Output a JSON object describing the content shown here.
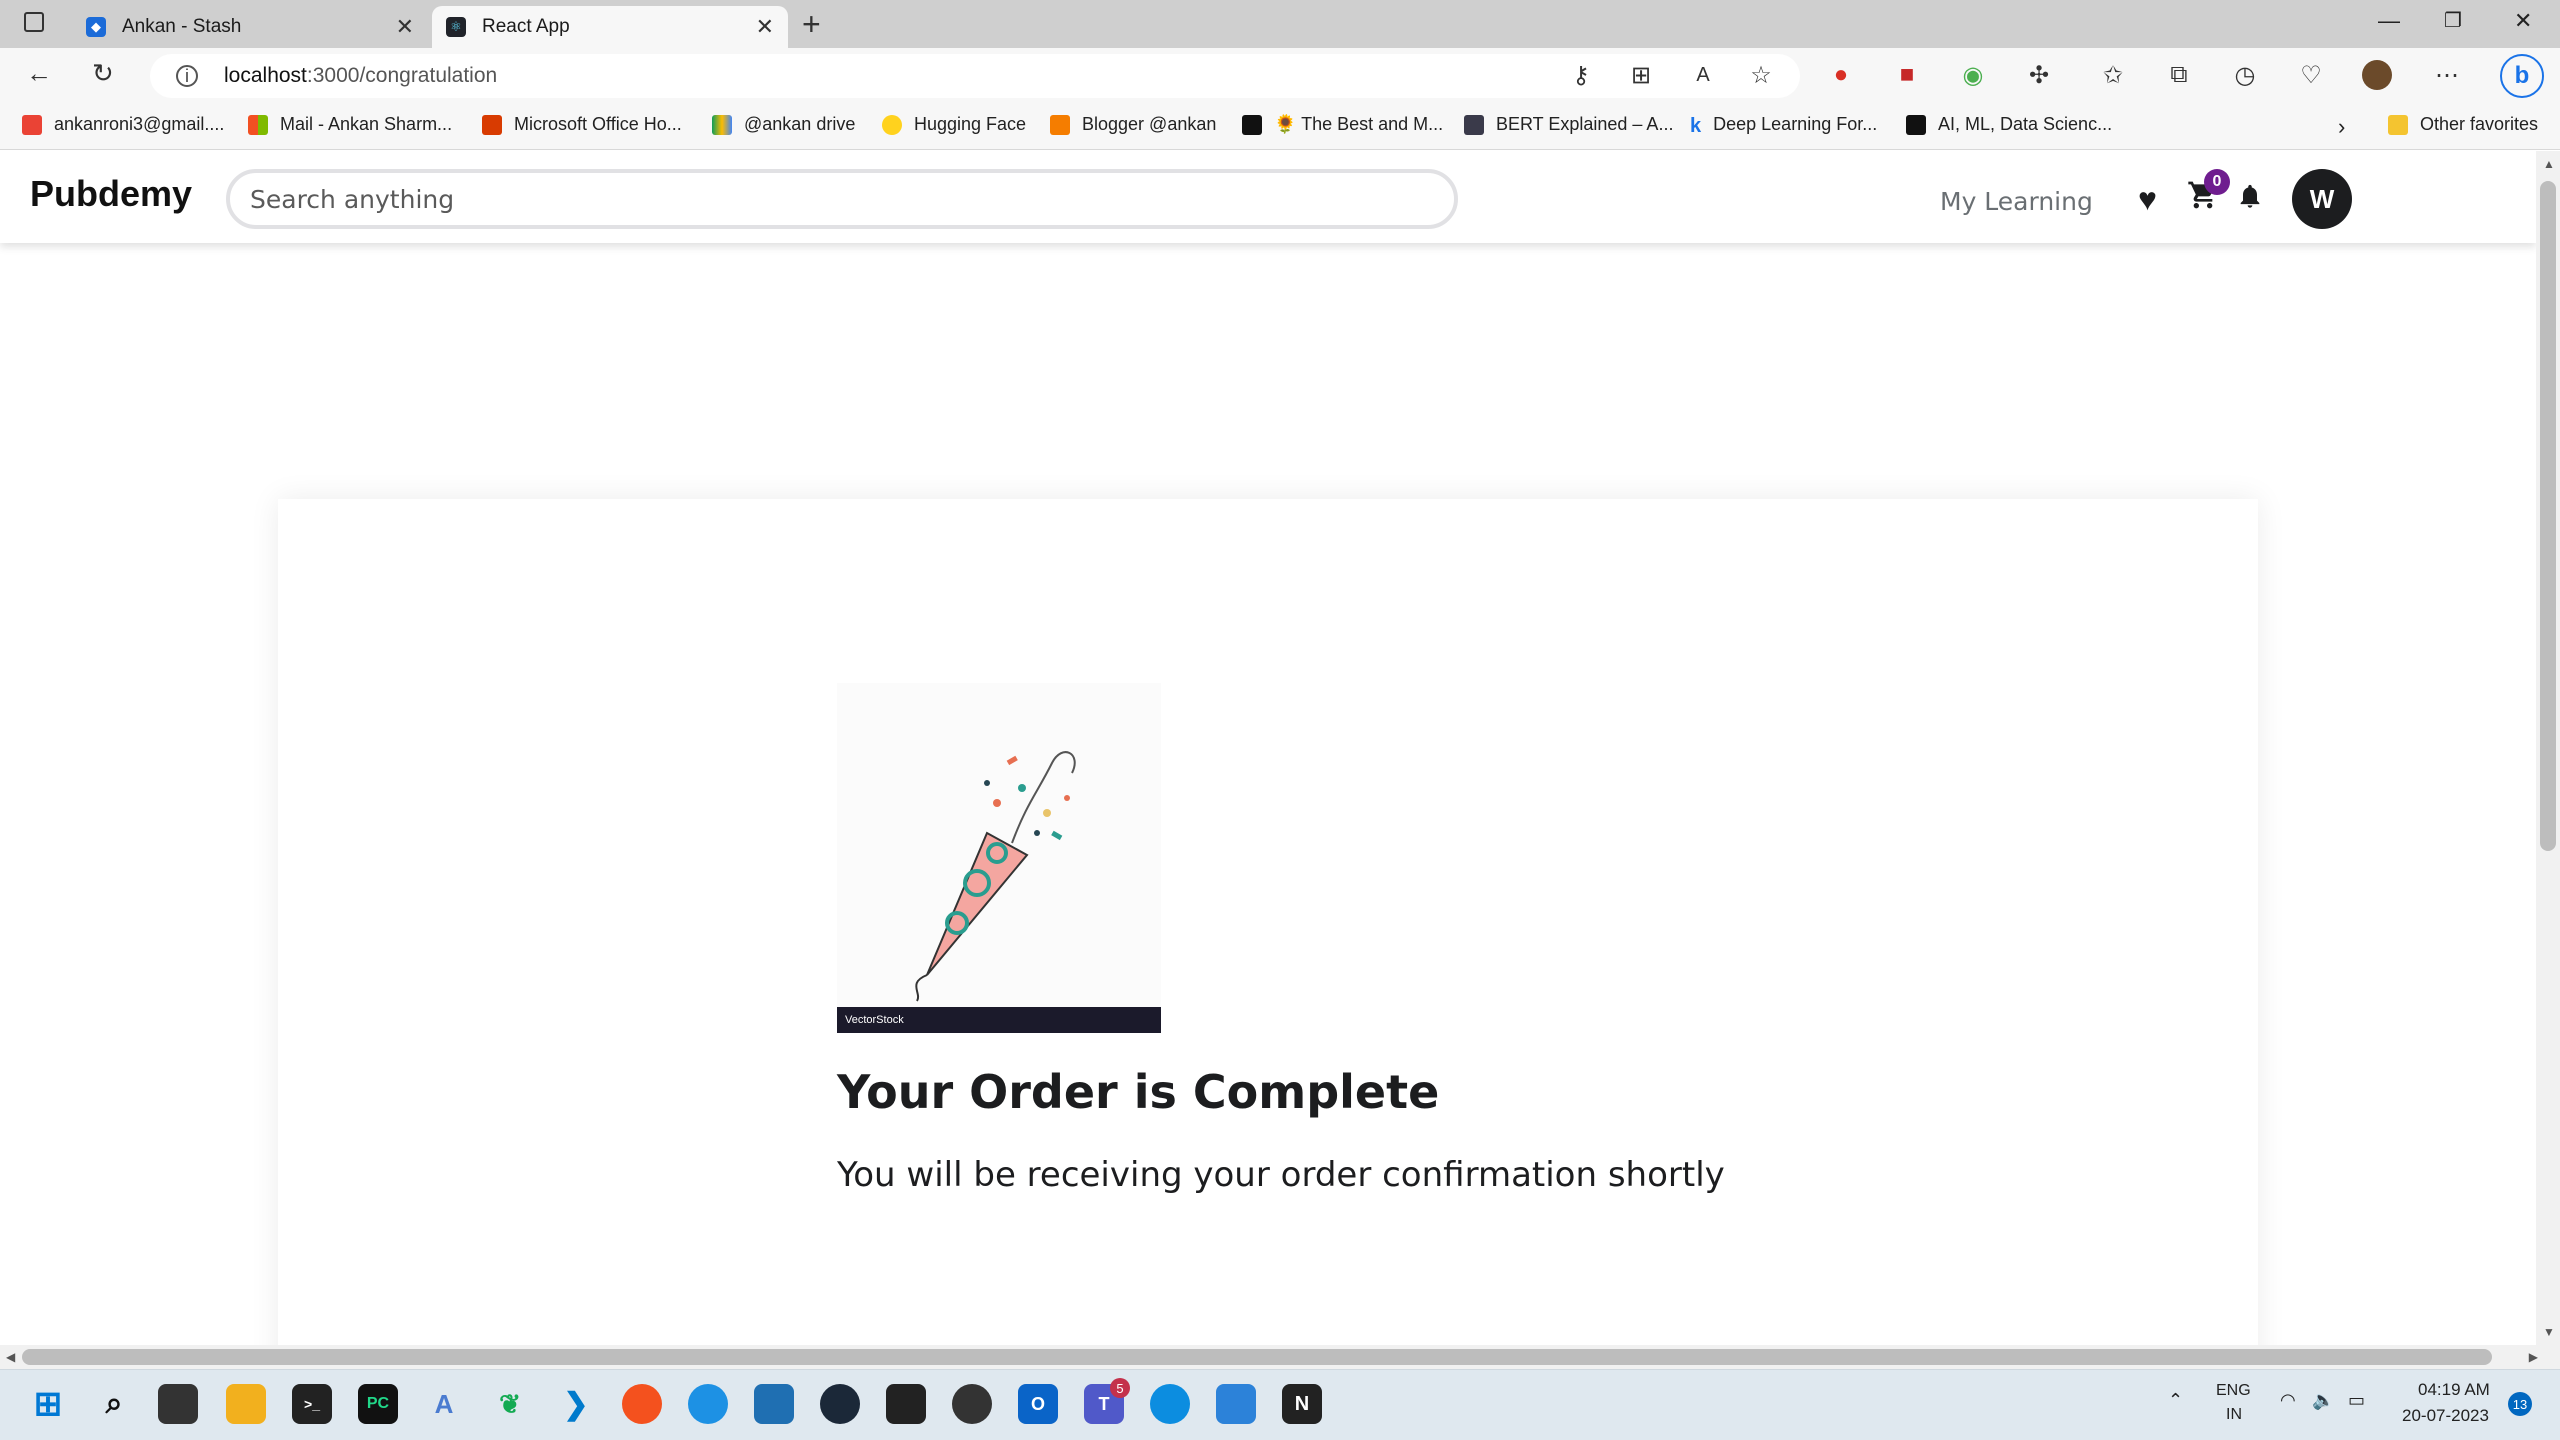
{
  "browser": {
    "tabs": [
      {
        "title": "Ankan - Stash"
      },
      {
        "title": "React App"
      }
    ],
    "url_host": "localhost",
    "url_path": ":3000/congratulation",
    "bookmarks": [
      {
        "label": "ankanroni3@gmail...."
      },
      {
        "label": "Mail - Ankan Sharm..."
      },
      {
        "label": "Microsoft Office Ho..."
      },
      {
        "label": "@ankan drive"
      },
      {
        "label": "Hugging Face"
      },
      {
        "label": "Blogger @ankan"
      },
      {
        "label": "🌻 The Best and M..."
      },
      {
        "label": "BERT Explained – A..."
      },
      {
        "label": "Deep Learning For..."
      },
      {
        "label": "AI, ML, Data Scienc..."
      }
    ],
    "other_favorites": "Other favorites"
  },
  "app": {
    "logo": "Pubdemy",
    "search_placeholder": "Search anything",
    "my_learning": "My Learning",
    "cart_count": "0",
    "avatar_initial": "W"
  },
  "main": {
    "image_watermark": "VectorStock",
    "title": "Your Order is Complete",
    "subtitle": "You will be receiving your order confirmation shortly"
  },
  "taskbar": {
    "lang_top": "ENG",
    "lang_bottom": "IN",
    "time": "04:19 AM",
    "date": "20-07-2023",
    "notif_count": "13",
    "teams_badge": "5"
  }
}
